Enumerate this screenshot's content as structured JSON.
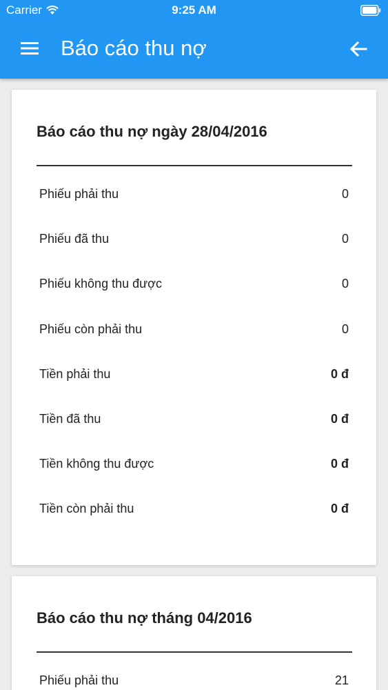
{
  "status_bar": {
    "carrier": "Carrier",
    "time": "9:25 AM"
  },
  "app_bar": {
    "title": "Báo cáo thu nợ",
    "menu_icon": "hamburger-menu-icon",
    "back_icon": "arrow-back-icon",
    "color": "#2196f3"
  },
  "day_report": {
    "title": "Báo cáo thu nợ ngày 28/04/2016",
    "rows": [
      {
        "label": "Phiếu phải thu",
        "value": "0"
      },
      {
        "label": "Phiếu đã thu",
        "value": "0"
      },
      {
        "label": "Phiếu không thu được",
        "value": "0"
      },
      {
        "label": "Phiếu còn phải thu",
        "value": "0"
      },
      {
        "label": "Tiền phải thu",
        "value": "0 đ"
      },
      {
        "label": "Tiền đã thu",
        "value": "0 đ"
      },
      {
        "label": "Tiền không thu được",
        "value": "0 đ"
      },
      {
        "label": "Tiền còn phải thu",
        "value": "0 đ"
      }
    ]
  },
  "month_report": {
    "title": "Báo cáo thu nợ tháng 04/2016",
    "rows": [
      {
        "label": "Phiếu phải thu",
        "value": "21"
      }
    ]
  }
}
